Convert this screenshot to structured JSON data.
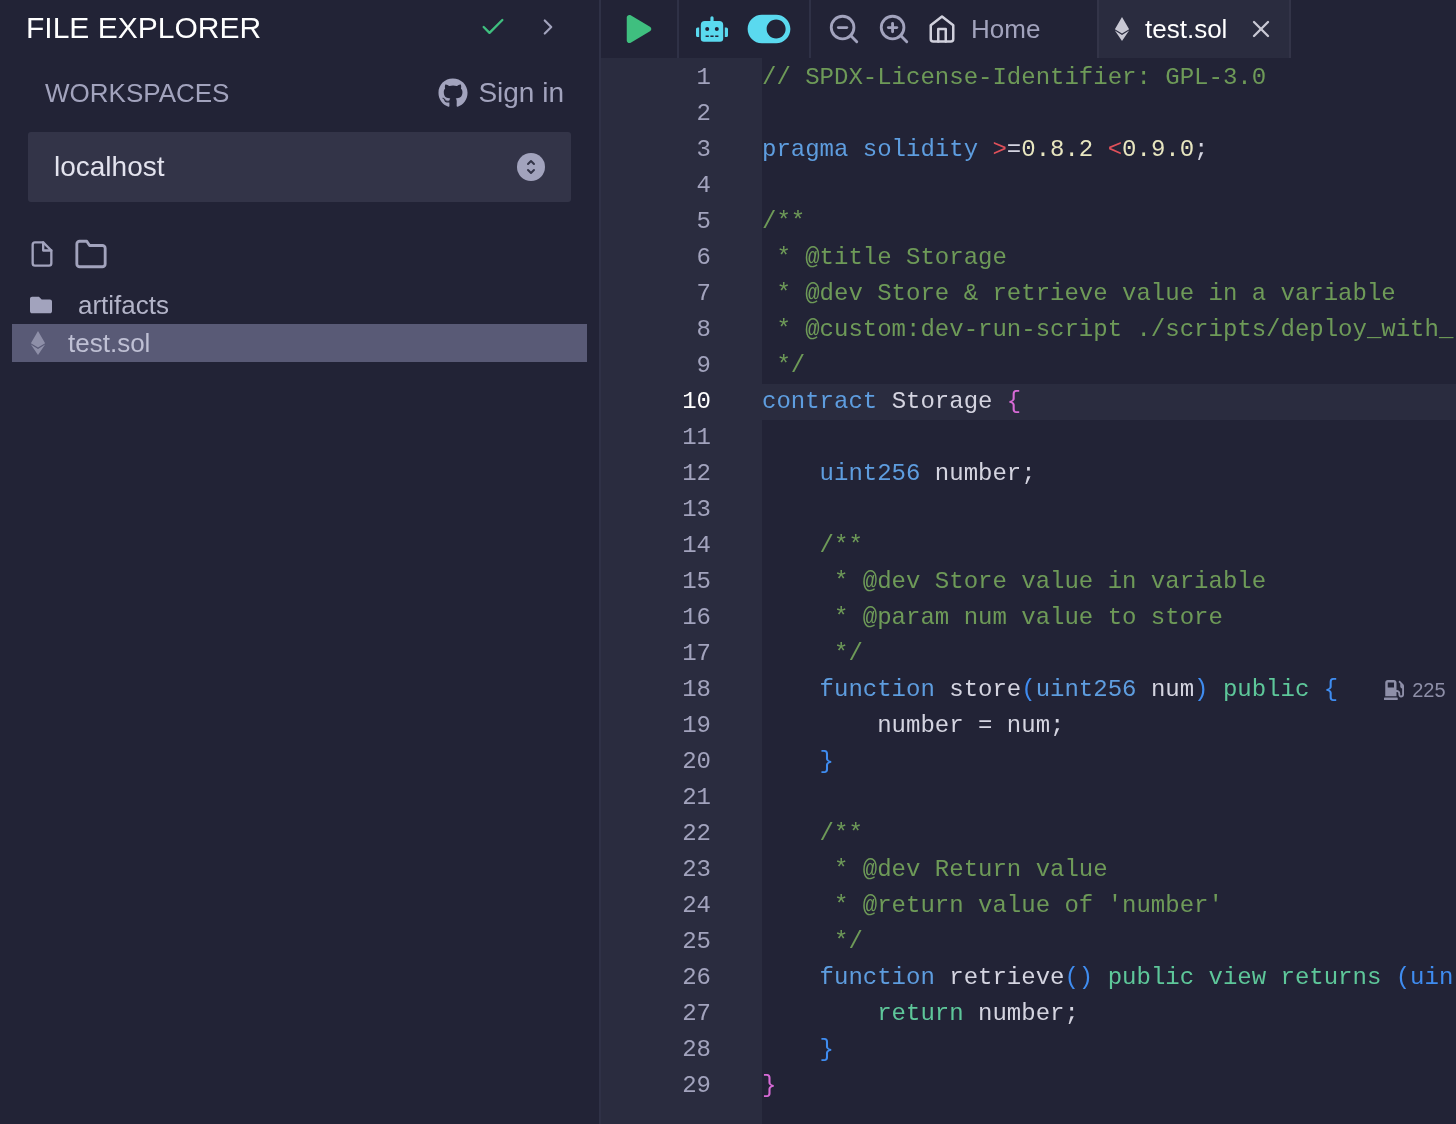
{
  "sidebar": {
    "title": "FILE EXPLORER",
    "workspaces_label": "WORKSPACES",
    "sign_in": "Sign in",
    "workspace_select": {
      "value": "localhost"
    },
    "files": [
      {
        "kind": "folder",
        "name": "artifacts",
        "selected": false
      },
      {
        "kind": "solidity",
        "name": "test.sol",
        "selected": true
      }
    ]
  },
  "toolbar": {
    "tabs": [
      {
        "kind": "home",
        "label": "Home",
        "selected": false
      },
      {
        "kind": "solidity",
        "label": "test.sol",
        "selected": true,
        "closable": true
      }
    ]
  },
  "editor": {
    "lines": [
      {
        "number": "1",
        "current": false,
        "tokens": [
          {
            "kind": "comment",
            "text": "// SPDX-License-Identifier: GPL-3.0"
          }
        ]
      },
      {
        "number": "2",
        "current": false
      },
      {
        "number": "3",
        "current": false,
        "tokens": [
          {
            "kind": "keyword",
            "text": "pragma solidity "
          },
          {
            "kind": "operator",
            "text": ">"
          },
          {
            "kind": "plain",
            "text": "="
          },
          {
            "kind": "number",
            "text": "0.8.2 "
          },
          {
            "kind": "operator",
            "text": "<"
          },
          {
            "kind": "number",
            "text": "0.9.0"
          },
          {
            "kind": "plain",
            "text": ";"
          }
        ]
      },
      {
        "number": "4",
        "current": false
      },
      {
        "number": "5",
        "current": false,
        "tokens": [
          {
            "kind": "comment",
            "text": "/**"
          }
        ]
      },
      {
        "number": "6",
        "current": false,
        "tokens": [
          {
            "kind": "comment",
            "text": " * @title Storage"
          }
        ]
      },
      {
        "number": "7",
        "current": false,
        "tokens": [
          {
            "kind": "comment",
            "text": " * @dev Store & retrieve value in a variable"
          }
        ]
      },
      {
        "number": "8",
        "current": false,
        "tokens": [
          {
            "kind": "comment",
            "text": " * @custom:dev-run-script ./scripts/deploy_with_"
          }
        ]
      },
      {
        "number": "9",
        "current": false,
        "tokens": [
          {
            "kind": "comment",
            "text": " */"
          }
        ]
      },
      {
        "number": "10",
        "current": true,
        "tokens": [
          {
            "kind": "keyword",
            "text": "contract "
          },
          {
            "kind": "plain",
            "text": "Storage "
          },
          {
            "kind": "brace",
            "text": "{"
          }
        ]
      },
      {
        "number": "11",
        "current": false
      },
      {
        "number": "12",
        "current": false,
        "tokens": [
          {
            "kind": "keyword",
            "text": "    uint256 "
          },
          {
            "kind": "plain",
            "text": "number;"
          }
        ]
      },
      {
        "number": "13",
        "current": false
      },
      {
        "number": "14",
        "current": false,
        "tokens": [
          {
            "kind": "comment",
            "text": "    /**"
          }
        ]
      },
      {
        "number": "15",
        "current": false,
        "tokens": [
          {
            "kind": "comment",
            "text": "     * @dev Store value in variable"
          }
        ]
      },
      {
        "number": "16",
        "current": false,
        "tokens": [
          {
            "kind": "comment",
            "text": "     * @param num value to store"
          }
        ]
      },
      {
        "number": "17",
        "current": false,
        "tokens": [
          {
            "kind": "comment",
            "text": "     */"
          }
        ]
      },
      {
        "number": "18",
        "current": false,
        "gas": "225",
        "tokens": [
          {
            "kind": "keyword",
            "text": "    function "
          },
          {
            "kind": "plain",
            "text": "store"
          },
          {
            "kind": "paren",
            "text": "("
          },
          {
            "kind": "keyword",
            "text": "uint256 "
          },
          {
            "kind": "plain",
            "text": "num"
          },
          {
            "kind": "paren",
            "text": ") "
          },
          {
            "kind": "modifier",
            "text": "public "
          },
          {
            "kind": "paren",
            "text": "{"
          }
        ]
      },
      {
        "number": "19",
        "current": false,
        "tokens": [
          {
            "kind": "plain",
            "text": "        number = num;"
          }
        ]
      },
      {
        "number": "20",
        "current": false,
        "tokens": [
          {
            "kind": "paren",
            "text": "    }"
          }
        ]
      },
      {
        "number": "21",
        "current": false
      },
      {
        "number": "22",
        "current": false,
        "tokens": [
          {
            "kind": "comment",
            "text": "    /**"
          }
        ]
      },
      {
        "number": "23",
        "current": false,
        "tokens": [
          {
            "kind": "comment",
            "text": "     * @dev Return value"
          }
        ]
      },
      {
        "number": "24",
        "current": false,
        "tokens": [
          {
            "kind": "comment",
            "text": "     * @return value of 'number'"
          }
        ]
      },
      {
        "number": "25",
        "current": false,
        "tokens": [
          {
            "kind": "comment",
            "text": "     */"
          }
        ]
      },
      {
        "number": "26",
        "current": false,
        "tokens": [
          {
            "kind": "keyword",
            "text": "    function "
          },
          {
            "kind": "plain",
            "text": "retrieve"
          },
          {
            "kind": "paren",
            "text": "() "
          },
          {
            "kind": "modifier",
            "text": "public view returns "
          },
          {
            "kind": "paren",
            "text": "(uin"
          }
        ]
      },
      {
        "number": "27",
        "current": false,
        "tokens": [
          {
            "kind": "modifier",
            "text": "        return "
          },
          {
            "kind": "plain",
            "text": "number;"
          }
        ]
      },
      {
        "number": "28",
        "current": false,
        "tokens": [
          {
            "kind": "paren",
            "text": "    }"
          }
        ]
      },
      {
        "number": "29",
        "current": false,
        "tokens": [
          {
            "kind": "brace",
            "text": "}"
          }
        ]
      }
    ]
  }
}
